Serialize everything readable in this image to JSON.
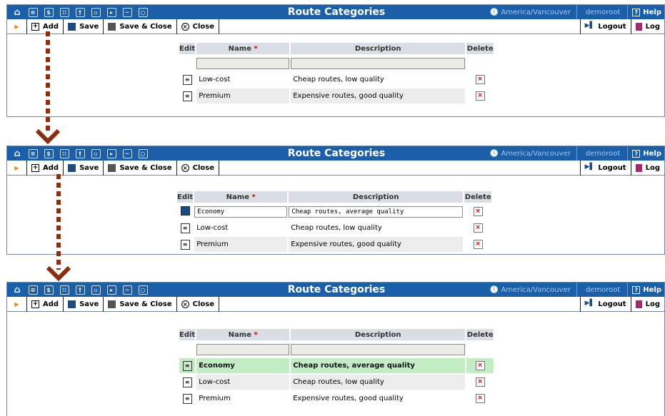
{
  "app": {
    "title": "Route Categories",
    "timezone": "America/Vancouver",
    "user": "demoroot",
    "help_label": "Help",
    "nav_icons": [
      "home-icon",
      "list-icon",
      "dollar-icon",
      "grid-icon",
      "person-icon",
      "tariff-icon",
      "export-icon",
      "chart-icon",
      "search-icon"
    ]
  },
  "toolbar": {
    "add_label": "Add",
    "save_label": "Save",
    "save_close_label": "Save & Close",
    "close_label": "Close",
    "logout_label": "Logout",
    "log_label": "Log"
  },
  "table": {
    "headers": {
      "edit": "Edit",
      "name": "Name",
      "name_required": "*",
      "description": "Description",
      "delete": "Delete"
    }
  },
  "screens": [
    {
      "step": "before-add",
      "rows": [
        {
          "name": "Low-cost",
          "description": "Cheap routes, low quality"
        },
        {
          "name": "Premium",
          "description": "Expensive routes, good quality"
        }
      ]
    },
    {
      "step": "editing-new-row",
      "new_row": {
        "name_value": "Economy",
        "description_value": "Cheap routes, average quality"
      },
      "rows": [
        {
          "name": "Low-cost",
          "description": "Cheap routes, low quality"
        },
        {
          "name": "Premium",
          "description": "Expensive routes, good quality"
        }
      ]
    },
    {
      "step": "after-save",
      "rows": [
        {
          "name": "Economy",
          "description": "Cheap routes, average quality",
          "highlight": true
        },
        {
          "name": "Low-cost",
          "description": "Cheap routes, low quality"
        },
        {
          "name": "Premium",
          "description": "Expensive routes, good quality"
        }
      ]
    }
  ],
  "colors": {
    "titlebar": "#1b5fa8",
    "highlight_row": "#c4ecc4",
    "flow_arrow": "#8b2f12"
  }
}
